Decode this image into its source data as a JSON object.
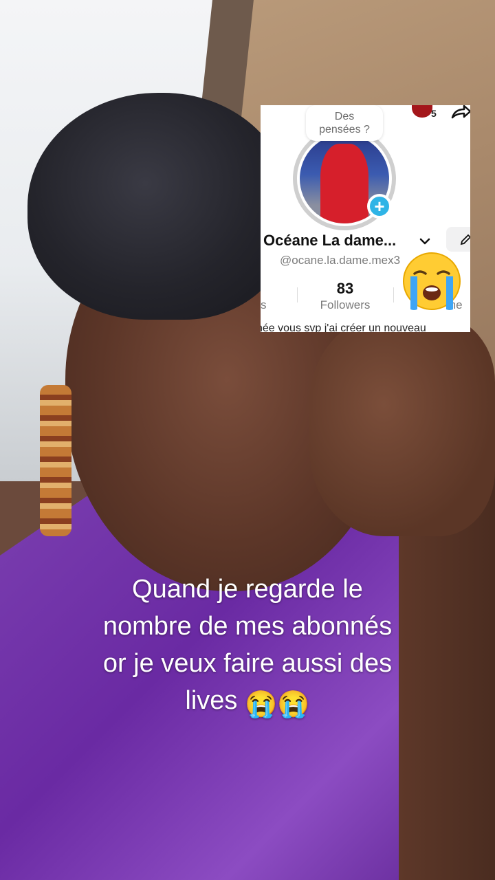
{
  "profile_card": {
    "thought_bubble": {
      "line1": "Des",
      "line2": "pensées ?"
    },
    "top_count": "5",
    "display_name": "Océane La dame...",
    "username": "@ocane.la.dame.mex3",
    "stats": {
      "left_label_fragment": "s",
      "followers_count": "83",
      "followers_label": "Followers",
      "right_label_fragment": "me"
    },
    "bio_fragment": "née vous svp j'ai créer un nouveau",
    "icons": {
      "add_story": "plus-icon",
      "share": "share-icon",
      "dropdown": "chevron-down-icon",
      "edit": "pencil-icon"
    }
  },
  "overlay_emoji": "loudly-crying-face",
  "caption": {
    "line1": "Quand je regarde le",
    "line2": "nombre de mes abonnés",
    "line3": "or je veux faire aussi des",
    "line4": "lives",
    "emoji": "😭😭"
  }
}
